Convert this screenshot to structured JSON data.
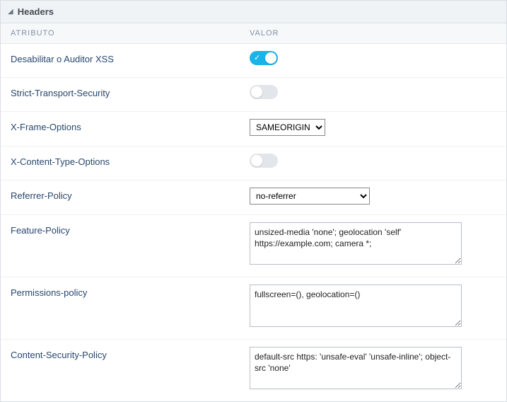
{
  "panel": {
    "title": "Headers"
  },
  "columns": {
    "attribute": "ATRIBUTO",
    "value": "VALOR"
  },
  "rows": {
    "xss": {
      "label": "Desabilitar o Auditor XSS",
      "enabled": true
    },
    "hsts": {
      "label": "Strict-Transport-Security",
      "enabled": false
    },
    "xframe": {
      "label": "X-Frame-Options",
      "selected": "SAMEORIGIN",
      "options": [
        "SAMEORIGIN"
      ]
    },
    "xcto": {
      "label": "X-Content-Type-Options",
      "enabled": false
    },
    "referrer": {
      "label": "Referrer-Policy",
      "selected": "no-referrer",
      "options": [
        "no-referrer"
      ]
    },
    "feature": {
      "label": "Feature-Policy",
      "value": "unsized-media 'none'; geolocation 'self' https://example.com; camera *;"
    },
    "permissions": {
      "label": "Permissions-policy",
      "value": "fullscreen=(), geolocation=()"
    },
    "csp": {
      "label": "Content-Security-Policy",
      "value": "default-src https: 'unsafe-eval' 'unsafe-inline'; object-src 'none'"
    }
  }
}
